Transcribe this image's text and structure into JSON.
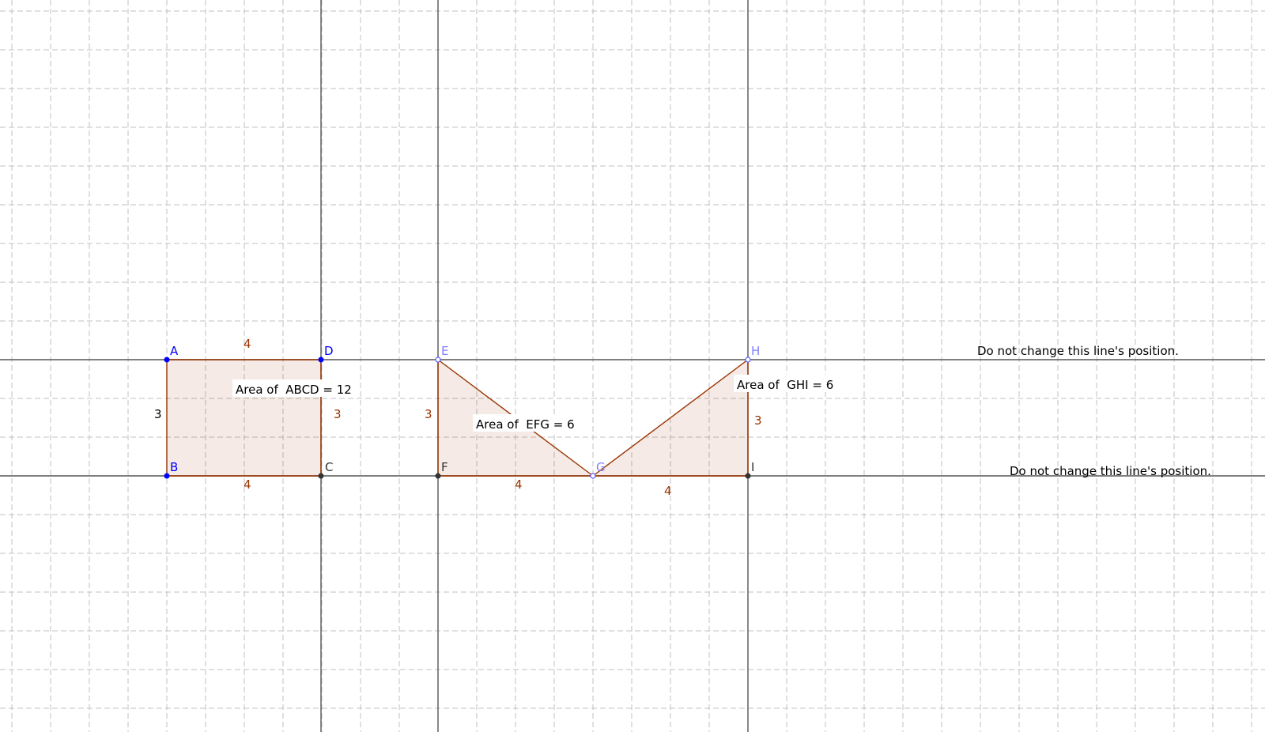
{
  "colors": {
    "point_free": "#0000ff",
    "point_light": "#7f7fff",
    "point_fixed": "#333333",
    "segment_label": "#993300",
    "text": "#000000"
  },
  "points": [
    {
      "name": "A",
      "style": "free"
    },
    {
      "name": "B",
      "style": "free"
    },
    {
      "name": "C",
      "style": "fixed"
    },
    {
      "name": "D",
      "style": "free"
    },
    {
      "name": "E",
      "style": "light"
    },
    {
      "name": "F",
      "style": "fixed"
    },
    {
      "name": "G",
      "style": "light"
    },
    {
      "name": "H",
      "style": "light"
    },
    {
      "name": "I",
      "style": "fixed"
    }
  ],
  "segments": {
    "AD": "4",
    "AB": "3",
    "DC": "3",
    "BC": "4",
    "EF": "3",
    "FG": "4",
    "GI": "4",
    "HI": "3"
  },
  "area_labels": {
    "abcd": "Area of  ABCD = 12",
    "efg": "Area of  EFG = 6",
    "ghi": "Area of  GHI = 6"
  },
  "notes": {
    "top_line": "Do not change this line's position.",
    "bottom_line": "Do not change this line's position."
  }
}
